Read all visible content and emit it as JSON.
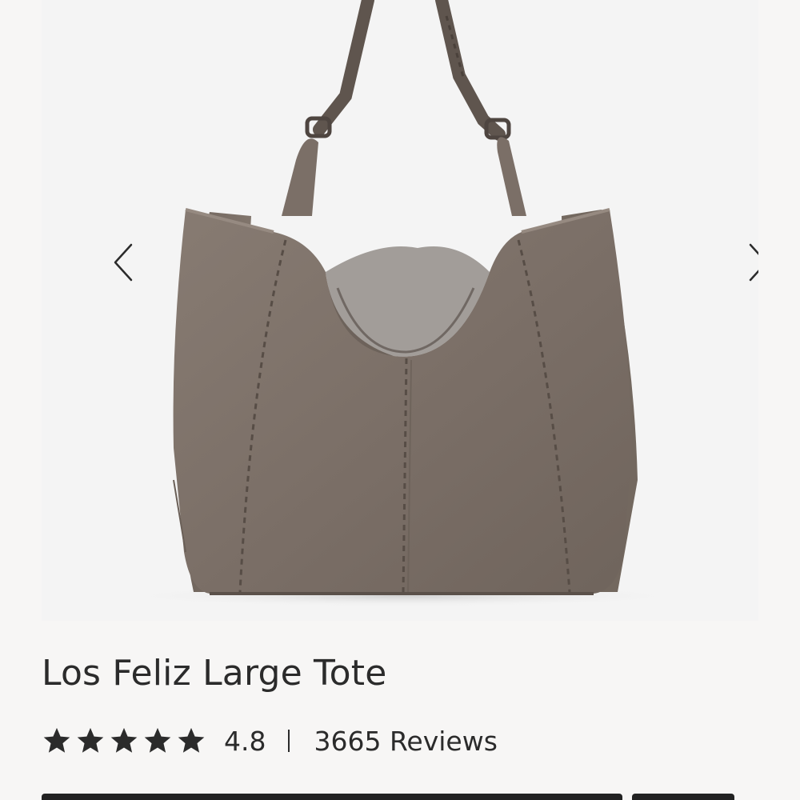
{
  "product": {
    "title": "Los Feliz Large Tote",
    "image_alt": "Los Feliz Large Tote in taupe suede",
    "colors": {
      "bag": "#7d7169",
      "bag_shadow": "#5e544d",
      "stitch": "#5a4f48"
    }
  },
  "gallery": {
    "prev_icon": "chevron-left-icon",
    "next_icon": "chevron-right-icon"
  },
  "rating": {
    "stars": 5,
    "value": "4.8",
    "separator": "|",
    "reviews_label": "3665 Reviews",
    "star_icon": "star-icon"
  }
}
